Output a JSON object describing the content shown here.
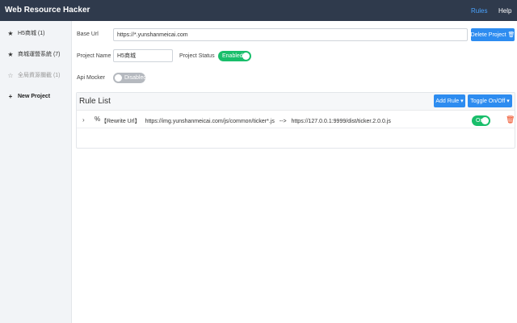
{
  "header": {
    "title": "Web Resource Hacker",
    "nav": [
      {
        "label": "Rules",
        "active": true
      },
      {
        "label": "Help",
        "active": false
      }
    ],
    "bg_color": "#2f3a4c",
    "active_color": "#4aa3ff"
  },
  "sidebar": {
    "items": [
      {
        "label": "H5商城 (1)",
        "icon": "star-icon",
        "glyph": "★",
        "state": "normal"
      },
      {
        "label": "商城運營系統 (7)",
        "icon": "star-icon",
        "glyph": "★",
        "state": "normal"
      },
      {
        "label": "全局資源攔截 (1)",
        "icon": "star-outline-icon",
        "glyph": "☆",
        "state": "disabled"
      },
      {
        "label": "New Project",
        "icon": "plus-icon",
        "glyph": "+",
        "state": "new"
      }
    ]
  },
  "form": {
    "base_url_label": "Base Url",
    "base_url_value": "https://*.yunshanmeicai.com",
    "delete_button": "Delete Project 🗑",
    "project_name_label": "Project Name",
    "project_name_value": "H5商城",
    "project_status_label": "Project Status",
    "project_status_value": "Enabled",
    "api_mocker_label": "Api Mocker",
    "api_mocker_value": "Disabled"
  },
  "rule_list": {
    "title": "Rule List",
    "add_rule_button": "Add Rule ▾",
    "toggle_button": "Toggle On/Off ▾",
    "rules": [
      {
        "type": "【Rewrite Url】",
        "from": "https://img.yunshanmeicai.com/js/common/ticker*.js",
        "arrow": "-->",
        "to": "https://127.0.0.1:9999/dist/ticker.2.0.0.js",
        "toggle": "On"
      }
    ]
  },
  "colors": {
    "primary": "#2d8cf0",
    "success": "#19be6b",
    "danger": "#ed4014",
    "disabled": "#b5b9bf"
  }
}
